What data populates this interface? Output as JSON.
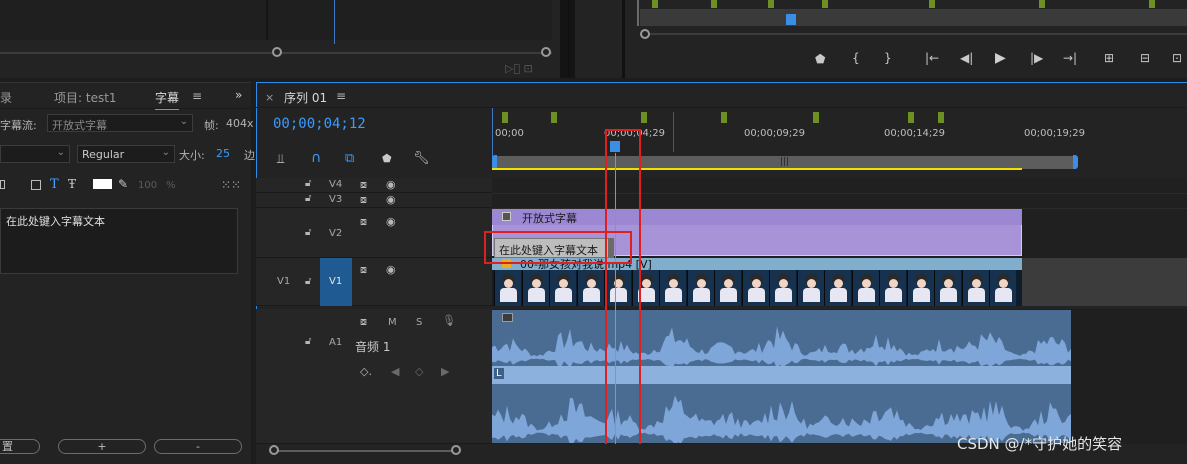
{
  "captions_panel": {
    "tabs": [
      "录",
      "项目: test1",
      "字幕"
    ],
    "menu_icon": "hamburger-icon",
    "overflow_icon": "double-chevron-right-icon",
    "stream_label": "字幕流:",
    "stream_value": "开放式字幕",
    "frame_label": "帧:",
    "frame_value": "404x",
    "font_style": "Regular",
    "size_label": "大小:",
    "size_value": "25",
    "cutoff_char": "边",
    "opacity_value": "100",
    "opacity_unit": "%",
    "caption_text": "在此处键入字幕文本",
    "footer_left": "置",
    "add_button": "+",
    "remove_button": "-"
  },
  "sequence": {
    "tab_close": "×",
    "tab_label": "序列 01",
    "timecode": "00;00;04;12",
    "ruler": [
      "00;00",
      "00;00;04;29",
      "00;00;09;29",
      "00;00;14;29",
      "00;00;19;29"
    ],
    "tracks": {
      "v4": "V4",
      "v3": "V3",
      "v2": "V2",
      "v1_src": "V1",
      "v1": "V1",
      "a1": "A1",
      "a1_name": "音频 1",
      "mute": "M",
      "solo": "S"
    },
    "clips": {
      "caption_track": "开放式字幕",
      "caption_item": "在此处键入字幕文本",
      "video": "00-那女孩对我说.mp4 [V]",
      "audio_channel": "L"
    }
  },
  "watermark": "CSDN @/*守护她的笑容",
  "colors": {
    "accent_blue": "#2d8ceb",
    "caption_purple": "#a893d9",
    "audio_blue": "#7ea6d8",
    "marker_green": "#6e8f23",
    "work_area_yellow": "#f0e000",
    "highlight_red": "#e02020"
  }
}
